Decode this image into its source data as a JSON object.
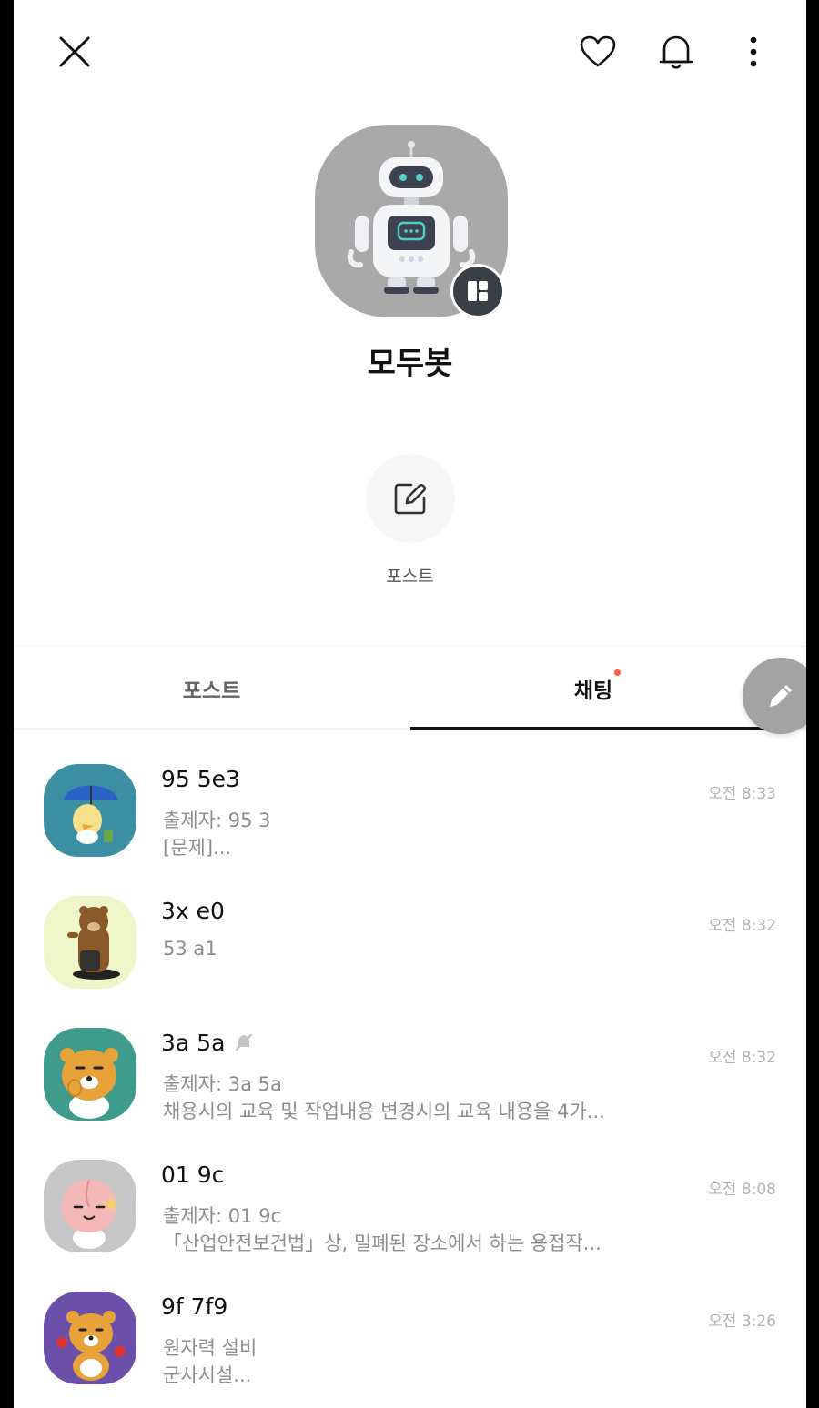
{
  "header": {
    "close_icon": "close-icon",
    "heart_icon": "heart-icon",
    "bell_icon": "bell-icon",
    "more_icon": "more-vertical-icon"
  },
  "profile": {
    "name": "모두봇",
    "avatar": "robot-avatar",
    "badge_icon": "grid-layout-icon"
  },
  "quick_action": {
    "icon": "edit-icon",
    "label": "포스트"
  },
  "tabs": [
    {
      "label": "포스트",
      "active": false
    },
    {
      "label": "채팅",
      "active": true,
      "has_new_dot": true
    }
  ],
  "fab": {
    "icon": "pencil-icon"
  },
  "chats": [
    {
      "title": "95        5e3",
      "line1": "출제자: 95            3",
      "line2": "[문제]...",
      "time": "오전 8:33",
      "muted": false,
      "avatar": "duck-umbrella-avatar"
    },
    {
      "title": "3x          e0",
      "line1": "53          a1",
      "line2": "",
      "time": "오전 8:32",
      "muted": false,
      "avatar": "bear-walking-avatar"
    },
    {
      "title": "3a          5a",
      "line1": "출제자: 3a           5a",
      "line2": "채용시의 교육 및 작업내용 변경시의 교육 내용을 4가...",
      "time": "오전 8:32",
      "muted": true,
      "avatar": "lion-ryan-avatar"
    },
    {
      "title": "01          9c",
      "line1": "출제자: 01          9c",
      "line2": "「산업안전보건법」상, 밀폐된 장소에서 하는 용접작...",
      "time": "오전 8:08",
      "muted": false,
      "avatar": "peach-apeach-avatar"
    },
    {
      "title": "9f          7f9",
      "line1": "원자력 설비",
      "line2": "군사시설...",
      "time": "오전 3:26",
      "muted": false,
      "avatar": "lion-waving-avatar"
    }
  ],
  "colors": {
    "accent_dot": "#ff5a3c",
    "fab": "#a3a3a3",
    "avatar_bg": "#a9a9a9"
  }
}
